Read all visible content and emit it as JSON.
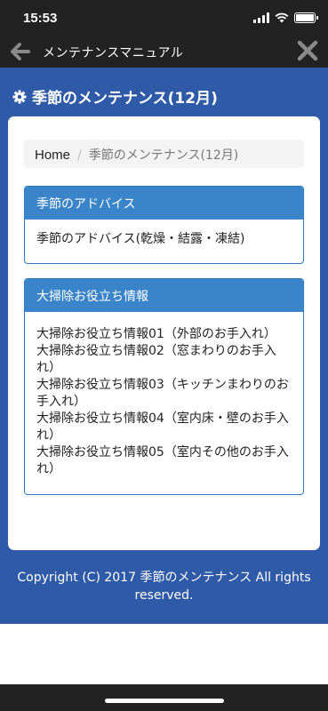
{
  "status": {
    "time": "15:53"
  },
  "nav": {
    "title": "メンテナンスマニュアル"
  },
  "page": {
    "title": "季節のメンテナンス(12月)"
  },
  "breadcrumb": {
    "home": "Home",
    "separator": "/",
    "current": "季節のメンテナンス(12月)"
  },
  "panels": [
    {
      "heading": "季節のアドバイス",
      "links": [
        "季節のアドバイス(乾燥・結露・凍結)"
      ]
    },
    {
      "heading": "大掃除お役立ち情報",
      "links": [
        "大掃除お役立ち情報01（外部のお手入れ）",
        "大掃除お役立ち情報02（窓まわりのお手入れ）",
        "大掃除お役立ち情報03（キッチンまわりのお手入れ）",
        "大掃除お役立ち情報04（室内床・壁のお手入れ）",
        "大掃除お役立ち情報05（室内その他のお手入れ）"
      ]
    }
  ],
  "footer": {
    "copyright": "Copyright (C) 2017 季節のメンテナンス All rights reserved."
  },
  "colors": {
    "nav_bg": "#222222",
    "main_bg": "#2e5aa8",
    "panel_head": "#3a85c9",
    "panel_border": "#2e7bc4"
  },
  "icons": {
    "back": "arrow-left-icon",
    "close": "close-icon",
    "title": "gear-icon"
  }
}
